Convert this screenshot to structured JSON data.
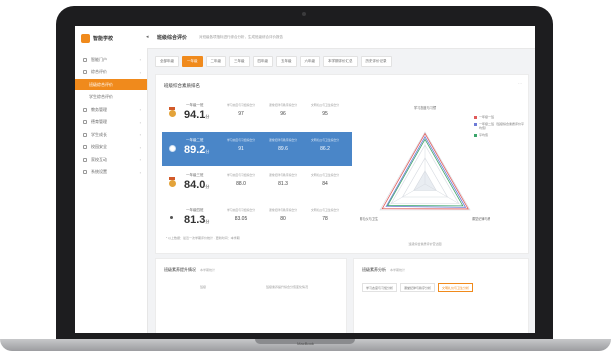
{
  "laptop": {
    "brand": "MacBook"
  },
  "sidebar": {
    "brand": "智能学校",
    "items": [
      {
        "label": "智能门户",
        "active": false,
        "sub": false
      },
      {
        "label": "综合评价",
        "active": false,
        "sub": false
      },
      {
        "label": "班级综合评价",
        "active": true,
        "sub": true
      },
      {
        "label": "学生综合评价",
        "active": false,
        "sub": true
      },
      {
        "label": "教务管理",
        "active": false,
        "sub": false
      },
      {
        "label": "德育管理",
        "active": false,
        "sub": false
      },
      {
        "label": "学生成长",
        "active": false,
        "sub": false
      },
      {
        "label": "校园安全",
        "active": false,
        "sub": false
      },
      {
        "label": "家校互动",
        "active": false,
        "sub": false
      },
      {
        "label": "系统设置",
        "active": false,
        "sub": false
      }
    ]
  },
  "topbar": {
    "title": "班级综合评价",
    "subtitle": "对班级各项指标进行综合分析，生成班级综合评价报告"
  },
  "tabs": [
    "全部年级",
    "一年级",
    "二年级",
    "三年级",
    "四年级",
    "五年级",
    "六年级",
    "本学期评价汇总",
    "历史评价记录"
  ],
  "active_tab": 1,
  "main_card": {
    "title": "班级综合素质排名",
    "more": "···",
    "metric_labels": [
      "学习态度与习惯综合分",
      "课堂纪律与秩序综合分",
      "文明礼仪与卫生综合分"
    ],
    "rows": [
      {
        "name": "一年级一班",
        "score": "94.1",
        "unit": "分",
        "metrics": [
          "97",
          "96",
          "95"
        ],
        "highlight": false,
        "medal": "gold"
      },
      {
        "name": "一年级二班",
        "score": "89.2",
        "unit": "分",
        "metrics": [
          "91",
          "89.6",
          "86.2"
        ],
        "highlight": true,
        "medal": "silver"
      },
      {
        "name": "一年级三班",
        "score": "84.0",
        "unit": "分",
        "metrics": [
          "88.0",
          "81.3",
          "84"
        ],
        "highlight": false,
        "medal": "bronze"
      },
      {
        "name": "一年级四班",
        "score": "81.3",
        "unit": "分",
        "metrics": [
          "83.05",
          "80",
          "78"
        ],
        "highlight": false,
        "medal": "none"
      }
    ],
    "footnote": "* 以上数据：最近一次学期评价统计 · 更新时间：本学期"
  },
  "radar": {
    "axes": [
      "学习态度与习惯",
      "课堂纪律与秩序",
      "文明礼仪与卫生"
    ],
    "caption": "班级综合素质评价雷达图",
    "legend": [
      {
        "name": "一年级一班",
        "color": "#e05a5a"
      },
      {
        "name": "一年级二班（班级综合素质评价平均值）",
        "color": "#6d7bd6"
      },
      {
        "name": "平均值",
        "color": "#3aa56a"
      }
    ]
  },
  "bottom_left": {
    "title": "班级素养提升情况",
    "subtitle": "本学期统计",
    "col1": "班级",
    "col2": "班级素养提升综合分值变化情况"
  },
  "bottom_right": {
    "title": "班级素养分析",
    "subtitle": "本学期统计",
    "tabs": [
      "学习态度与习惯分析",
      "课堂纪律与秩序分析",
      "文明礼仪与卫生分析"
    ],
    "active_tab": 2
  }
}
